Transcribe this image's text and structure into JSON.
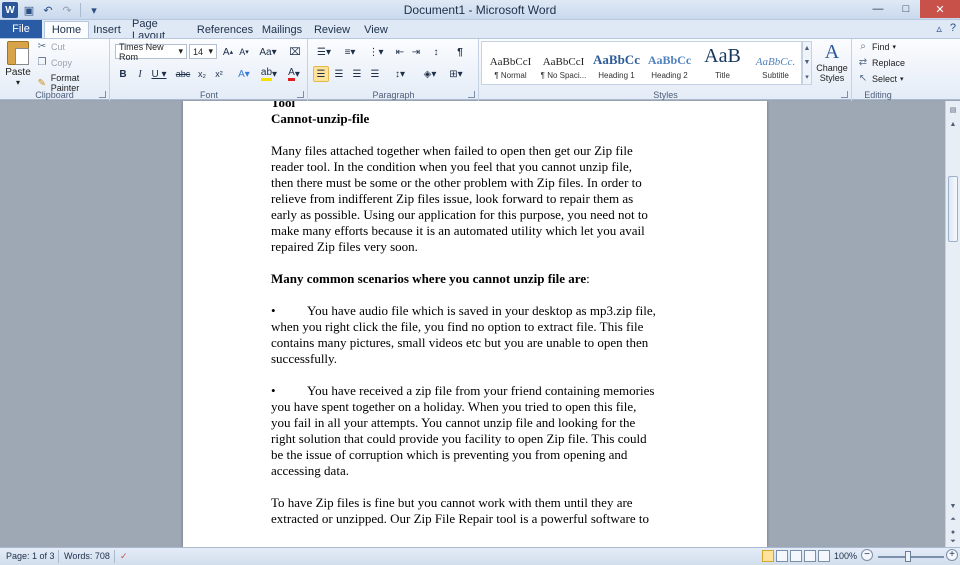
{
  "window": {
    "title": "Document1 - Microsoft Word",
    "minimize": "—",
    "maximize": "□",
    "close": "✕"
  },
  "tabs": [
    {
      "label": "File"
    },
    {
      "label": "Home"
    },
    {
      "label": "Insert"
    },
    {
      "label": "Page Layout"
    },
    {
      "label": "References"
    },
    {
      "label": "Mailings"
    },
    {
      "label": "Review"
    },
    {
      "label": "View"
    }
  ],
  "clipboard": {
    "paste": "Paste",
    "cut": "Cut",
    "copy": "Copy",
    "format_painter": "Format Painter",
    "label": "Clipboard"
  },
  "font": {
    "name": "Times New Rom",
    "size": "14",
    "label": "Font"
  },
  "paragraph": {
    "label": "Paragraph",
    "show_marks": "¶"
  },
  "styles": {
    "label": "Styles",
    "items": [
      {
        "preview": "AaBbCcI",
        "name": "¶ Normal"
      },
      {
        "preview": "AaBbCcI",
        "name": "¶ No Spaci..."
      },
      {
        "preview": "AaBbCc",
        "name": "Heading 1"
      },
      {
        "preview": "AaBbCc",
        "name": "Heading 2"
      },
      {
        "preview": "AaB",
        "name": "Title"
      },
      {
        "preview": "AaBbCc.",
        "name": "Subtitle"
      }
    ],
    "change_styles": "Change Styles"
  },
  "editing": {
    "find": "Find",
    "replace": "Replace",
    "select": "Select",
    "label": "Editing"
  },
  "document": {
    "line_top": "Tool",
    "heading": "Cannot-unzip-file",
    "para1": [
      "Many files attached together when failed to open then get our Zip file",
      "reader tool. In the condition when you feel that you cannot unzip file,",
      "then there must be some or the other problem with Zip files. In order to",
      "relieve from indifferent Zip files issue, look forward to repair them as",
      "early as possible. Using our application for this purpose, you need not to",
      "make many efforts because it is an automated utility which let you avail",
      "repaired Zip files very soon."
    ],
    "scenarios_heading": "Many common scenarios where you cannot unzip file are",
    "scenarios_colon": ":",
    "bullet": "•",
    "bullet1": [
      "You have audio file which is saved in your desktop as mp3.zip file,",
      "when you right click the file, you find no option to extract file. This file",
      "contains many pictures, small videos etc but you are unable to open then",
      "successfully."
    ],
    "bullet2": [
      "You have received a zip file from your friend containing memories",
      "you have spent together on a holiday. When you tried to open this file,",
      "you fail in all your attempts. You cannot unzip file and looking for the",
      "right solution that could provide you facility to open Zip file. This could",
      "be the issue of corruption which is preventing you from opening and",
      "accessing data."
    ],
    "para_last": [
      "To have Zip files is fine but you cannot work with them until they are",
      "extracted or unzipped. Our Zip File Repair tool is a powerful software to"
    ]
  },
  "status": {
    "page": "Page: 1 of 3",
    "words": "Words: 708",
    "zoom": "100%"
  },
  "colors": {
    "file_tab": "#2a5ba5",
    "accent": "#2b579a",
    "close": "#c8514a",
    "highlight": "#ffe39a"
  }
}
